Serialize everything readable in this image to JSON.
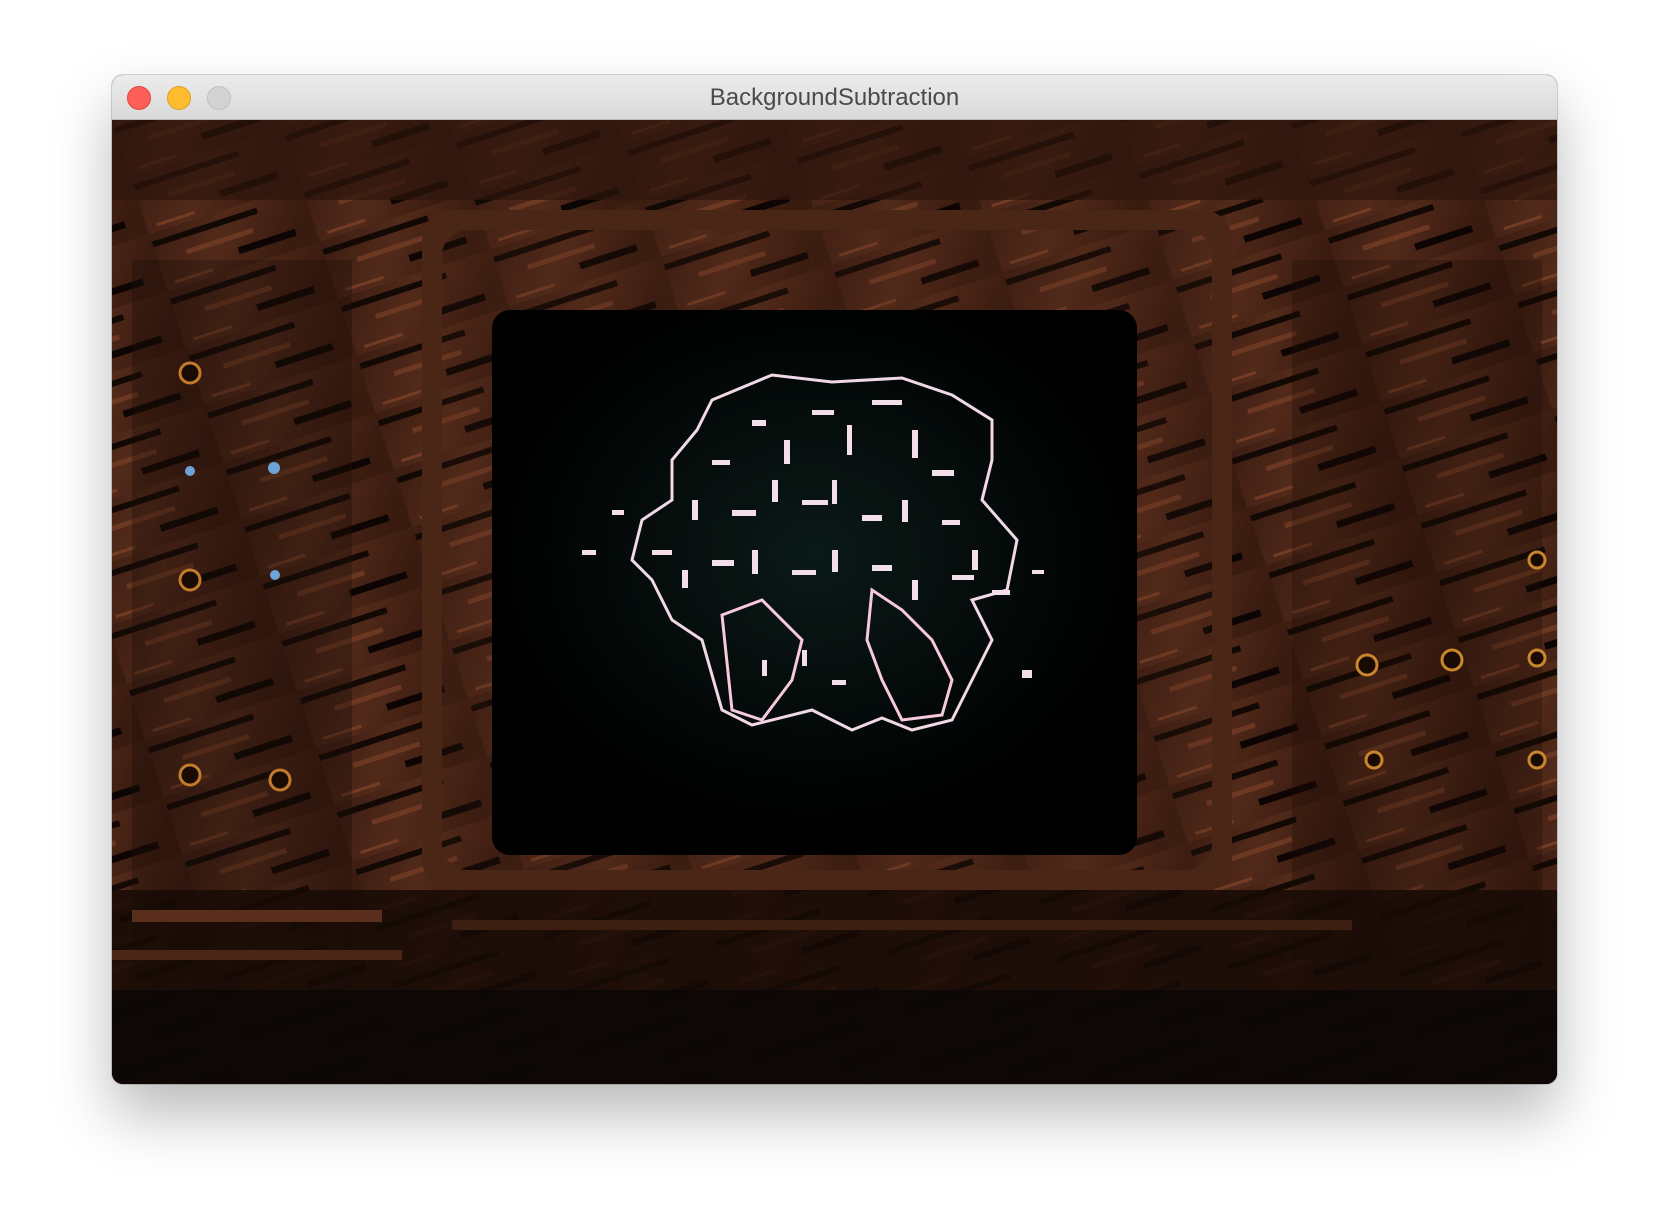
{
  "window": {
    "title": "BackgroundSubtraction",
    "controls": [
      "close",
      "minimize",
      "zoom"
    ]
  },
  "frame": {
    "description_icon": "video-frame",
    "colors": {
      "background": "#2a140c",
      "wood": "#5a2e1c",
      "screen": "#000000",
      "edges": "#f2d9e6"
    }
  }
}
